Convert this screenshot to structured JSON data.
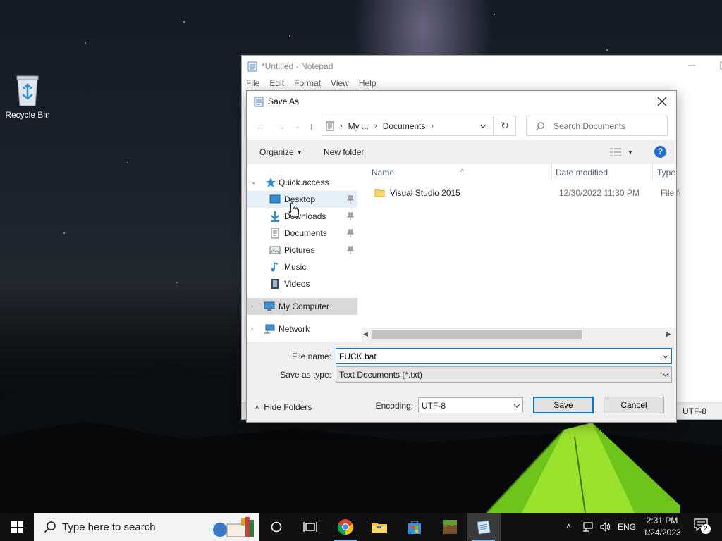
{
  "desktop": {
    "recycle_bin_label": "Recycle Bin"
  },
  "notepad": {
    "title": "*Untitled - Notepad",
    "menu": [
      "File",
      "Edit",
      "Format",
      "View",
      "Help"
    ],
    "status_encoding": "UTF-8"
  },
  "dialog": {
    "title": "Save As",
    "breadcrumb": [
      "My ...",
      "Documents"
    ],
    "search_placeholder": "Search Documents",
    "organize_label": "Organize",
    "new_folder_label": "New folder",
    "help_label": "?",
    "nav": {
      "quick_access": "Quick access",
      "desktop": "Desktop",
      "downloads": "Downloads",
      "documents": "Documents",
      "pictures": "Pictures",
      "music": "Music",
      "videos": "Videos",
      "my_computer": "My Computer",
      "network": "Network"
    },
    "columns": {
      "name": "Name",
      "date_modified": "Date modified",
      "type": "Type"
    },
    "files": [
      {
        "name": "Visual Studio 2015",
        "date": "12/30/2022 11:30 PM",
        "type": "File folder"
      }
    ],
    "file_name_label": "File name:",
    "file_name_value": "FUCK.bat",
    "save_as_type_label": "Save as type:",
    "save_as_type_value": "Text Documents (*.txt)",
    "hide_folders_label": "Hide Folders",
    "encoding_label": "Encoding:",
    "encoding_value": "UTF-8",
    "save_label": "Save",
    "cancel_label": "Cancel"
  },
  "taskbar": {
    "search_placeholder": "Type here to search",
    "language": "ENG",
    "time": "2:31 PM",
    "date": "1/24/2023",
    "notification_count": "2"
  },
  "colors": {
    "accent": "#0078d7",
    "selection": "#e5f0fb",
    "taskbar": "#101010"
  }
}
